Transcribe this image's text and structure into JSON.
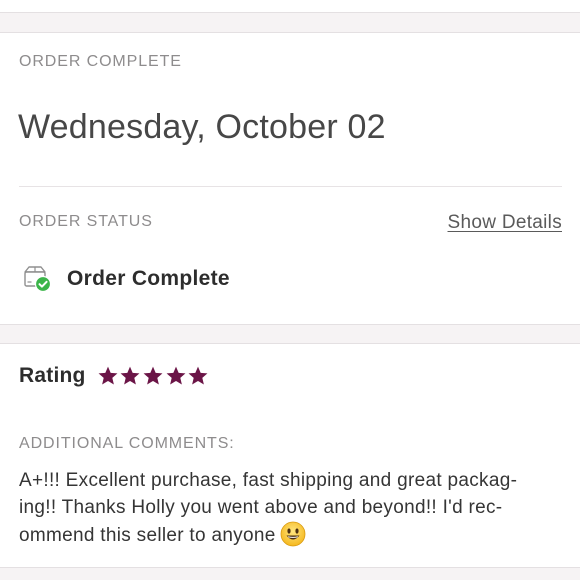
{
  "order": {
    "section_label": "ORDER COMPLETE",
    "date": "Wednesday, October 02",
    "status_label": "ORDER STATUS",
    "show_details": "Show Details",
    "status_text": "Order Complete"
  },
  "rating": {
    "label": "Rating",
    "stars": 5,
    "max_stars": 5,
    "star_color": "#6b1547",
    "comments_label": "ADDITIONAL COMMENTS:",
    "comment_lines": [
      "A+!!! Excellent purchase, fast shipping and great packag-",
      "ing!! Thanks Holly you went above and beyond!! I'd rec-",
      "ommend this seller to anyone"
    ],
    "emoji": "smiley-emoji"
  },
  "icons": {
    "status": "package-check-icon",
    "status_check_color": "#3cb54a"
  }
}
